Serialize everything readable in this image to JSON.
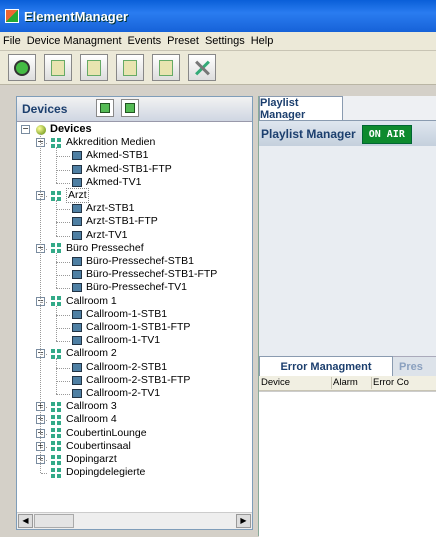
{
  "window": {
    "title": "ElementManager"
  },
  "menu": [
    "File",
    "Device Managment",
    "Events",
    "Preset",
    "Settings",
    "Help"
  ],
  "toolbar": {
    "icons": [
      "power-icon",
      "device-icon",
      "network-icon",
      "config-icon",
      "log-icon",
      "tools-icon"
    ]
  },
  "devices_panel": {
    "title": "Devices",
    "root": "Devices",
    "groups": [
      {
        "name": "Akkredition Medien",
        "expanded": true,
        "items": [
          "Akmed-STB1",
          "Akmed-STB1-FTP",
          "Akmed-TV1"
        ]
      },
      {
        "name": "Arzt",
        "expanded": true,
        "selected": true,
        "items": [
          "Arzt-STB1",
          "Arzt-STB1-FTP",
          "Arzt-TV1"
        ]
      },
      {
        "name": "Büro Pressechef",
        "expanded": true,
        "items": [
          "Büro-Pressechef-STB1",
          "Büro-Pressechef-STB1-FTP",
          "Büro-Pressechef-TV1"
        ]
      },
      {
        "name": "Callroom 1",
        "expanded": true,
        "items": [
          "Callroom-1-STB1",
          "Callroom-1-STB1-FTP",
          "Callroom-1-TV1"
        ]
      },
      {
        "name": "Callroom 2",
        "expanded": true,
        "items": [
          "Callroom-2-STB1",
          "Callroom-2-STB1-FTP",
          "Callroom-2-TV1"
        ]
      },
      {
        "name": "Callroom 3",
        "expanded": false,
        "items": []
      },
      {
        "name": "Callroom 4",
        "expanded": false,
        "items": []
      },
      {
        "name": "CoubertinLounge",
        "expanded": false,
        "items": []
      },
      {
        "name": "Coubertinsaal",
        "expanded": false,
        "items": []
      },
      {
        "name": "Dopingarzt",
        "expanded": false,
        "items": []
      },
      {
        "name": "Dopingdelegierte",
        "expanded": false,
        "items": [],
        "no_toggle": true
      }
    ]
  },
  "playlist": {
    "tab": "Playlist Manager",
    "header": "Playlist Manager",
    "status": "ON AIR"
  },
  "errors": {
    "tab": "Error Managment",
    "tab2": "Pres",
    "columns": [
      "Device",
      "Alarm",
      "Error Co"
    ]
  }
}
